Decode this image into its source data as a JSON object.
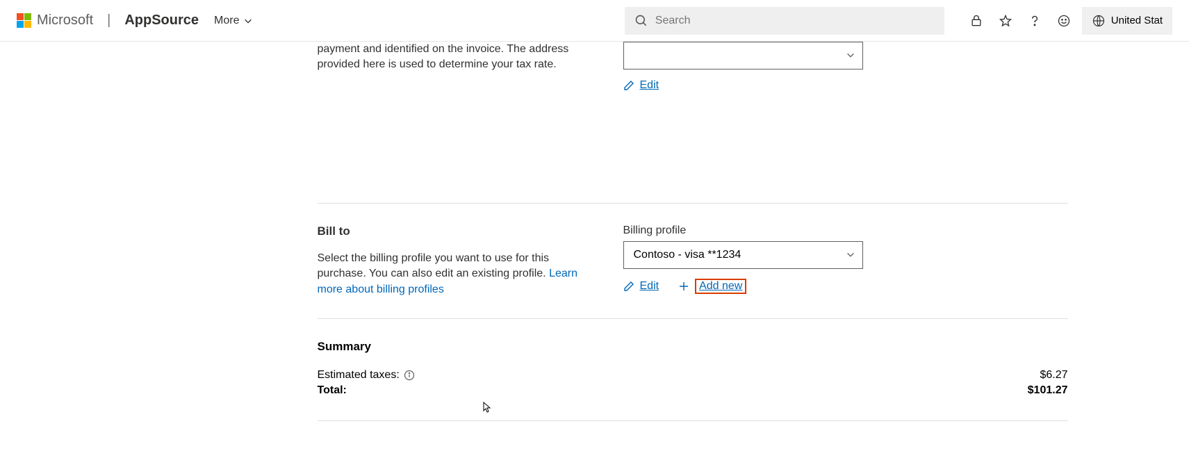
{
  "header": {
    "brand": "Microsoft",
    "appName": "AppSource",
    "moreLabel": "More",
    "searchPlaceholder": "Search",
    "localeLabel": "United Stat"
  },
  "soldTo": {
    "descriptionPartial": "payment and identified on the invoice. The address provided here is used to determine your tax rate.",
    "editLabel": "Edit"
  },
  "billTo": {
    "title": "Bill to",
    "description": "Select the billing profile you want to use for this purchase. You can also edit an existing profile. ",
    "learnLink": "Learn more about billing profiles",
    "fieldLabel": "Billing profile",
    "selectedValue": "Contoso - visa **1234",
    "editLabel": "Edit",
    "addNewLabel": "Add new"
  },
  "summary": {
    "title": "Summary",
    "taxesLabel": "Estimated taxes:",
    "taxesValue": "$6.27",
    "totalLabel": "Total:",
    "totalValue": "$101.27"
  }
}
